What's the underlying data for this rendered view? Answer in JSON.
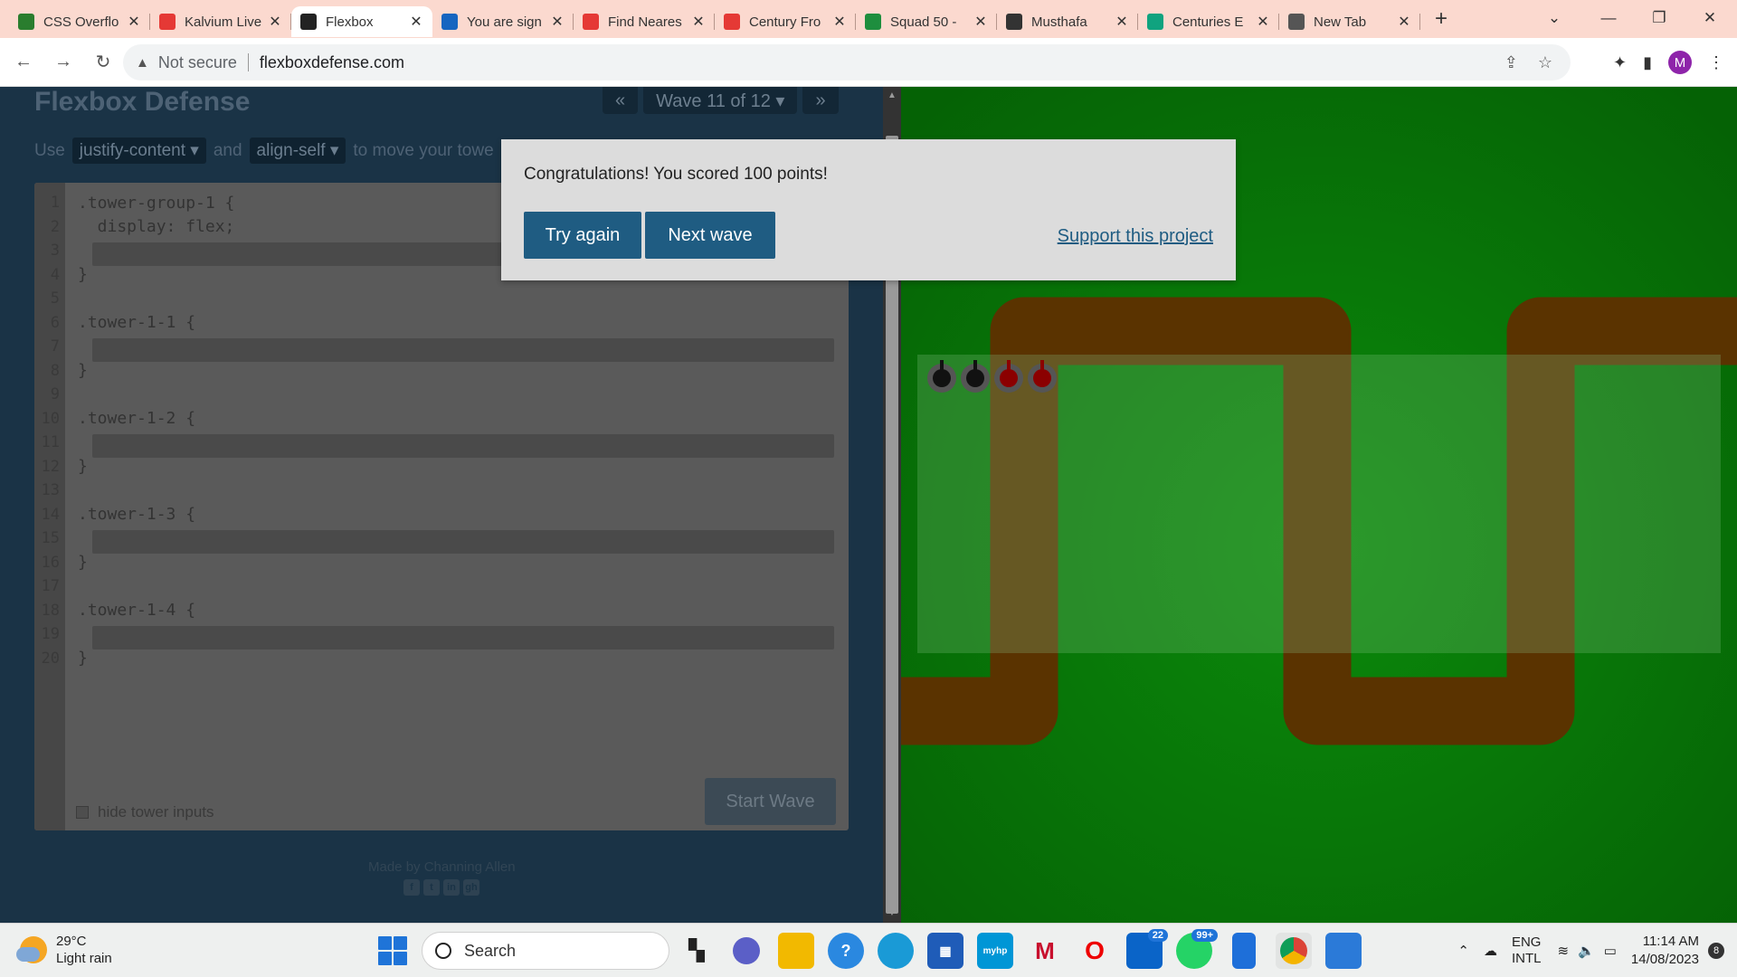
{
  "browser": {
    "tabs": [
      {
        "title": "CSS Overflo",
        "icon": "w-icon",
        "color": "#2a7d2e"
      },
      {
        "title": "Kalvium Live",
        "icon": "kalvium-icon",
        "color": "#e53935"
      },
      {
        "title": "Flexbox",
        "icon": "flexbox-icon",
        "color": "#222222",
        "active": true
      },
      {
        "title": "You are sign",
        "icon": "s-icon",
        "color": "#1565c0"
      },
      {
        "title": "Find Neares",
        "icon": "openai-icon",
        "color": "#e53935"
      },
      {
        "title": "Century Fro",
        "icon": "openai-icon",
        "color": "#e53935"
      },
      {
        "title": "Squad 50 -",
        "icon": "chat-icon",
        "color": "#1e8e3e"
      },
      {
        "title": "Musthafa",
        "icon": "notion-icon",
        "color": "#333333"
      },
      {
        "title": "Centuries E",
        "icon": "openai-icon",
        "color": "#10a37f"
      },
      {
        "title": "New Tab",
        "icon": "chrome-icon",
        "color": "#555555"
      }
    ],
    "not_secure": "Not secure",
    "url": "flexboxdefense.com",
    "profile_initial": "M"
  },
  "game": {
    "title": "Flexbox Defense",
    "wave_label": "Wave 11 of 12 ▾",
    "prev": "«",
    "next": "»",
    "instr_use": "Use",
    "instr_prop1": "justify-content ▾",
    "instr_and": "and",
    "instr_prop2": "align-self ▾",
    "instr_tail": "to move your towe",
    "line_numbers": [
      "1",
      "2",
      "3",
      "4",
      "5",
      "6",
      "7",
      "8",
      "9",
      "10",
      "11",
      "12",
      "13",
      "14",
      "15",
      "16",
      "17",
      "18",
      "19",
      "20"
    ],
    "code": {
      "l1": ".tower-group-1 {",
      "l2": "  display: flex;",
      "l4": "}",
      "l6": ".tower-1-1 {",
      "l8": "}",
      "l10": ".tower-1-2 {",
      "l12": "}",
      "l14": ".tower-1-3 {",
      "l16": "}",
      "l18": ".tower-1-4 {",
      "l20": "}"
    },
    "start_wave": "Start Wave",
    "hide_inputs": "hide tower inputs",
    "made_by": "Made by Channing Allen",
    "social": [
      "f",
      "t",
      "in",
      "gh"
    ]
  },
  "modal": {
    "message": "Congratulations! You scored 100 points!",
    "try_again": "Try again",
    "next_wave": "Next wave",
    "support": "Support this project"
  },
  "taskbar": {
    "temp": "29°C",
    "weather": "Light rain",
    "search": "Search",
    "badge_outlook": "22",
    "badge_whatsapp": "99+",
    "lang1": "ENG",
    "lang2": "INTL",
    "time": "11:14 AM",
    "date": "14/08/2023",
    "notif_count": "8"
  }
}
